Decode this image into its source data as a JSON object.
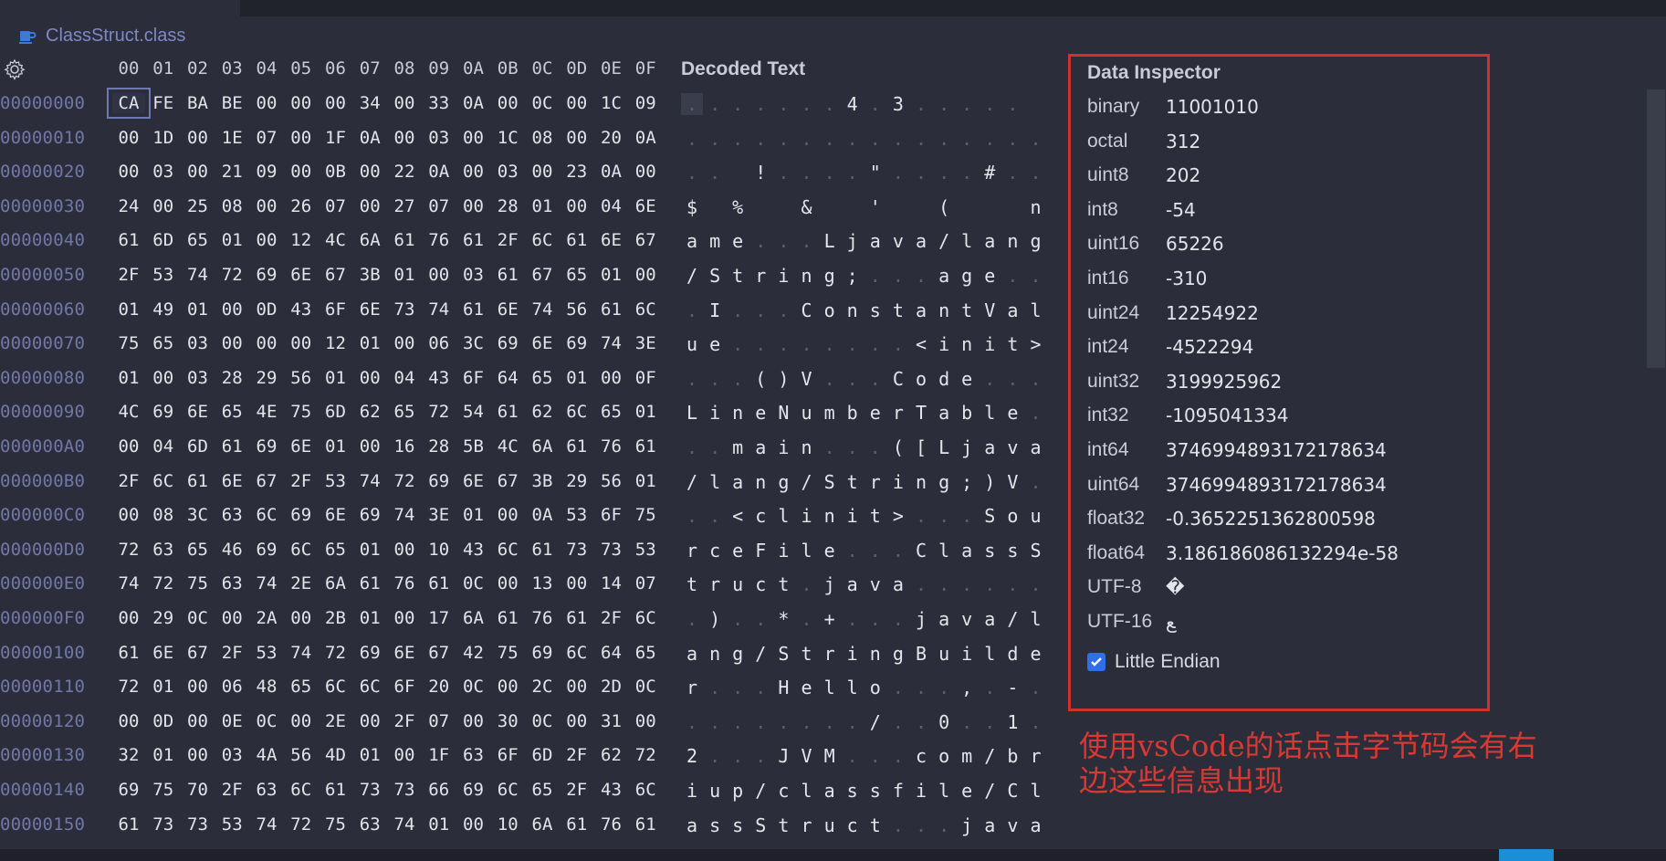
{
  "tab": {
    "title": "ClassStruct.class",
    "icon": "coffee-cup-icon"
  },
  "hex_columns": [
    "00",
    "01",
    "02",
    "03",
    "04",
    "05",
    "06",
    "07",
    "08",
    "09",
    "0A",
    "0B",
    "0C",
    "0D",
    "0E",
    "0F"
  ],
  "decoded_header": "Decoded Text",
  "rows": [
    {
      "addr": "00000000",
      "bytes": [
        "CA",
        "FE",
        "BA",
        "BE",
        "00",
        "00",
        "00",
        "34",
        "00",
        "33",
        "0A",
        "00",
        "0C",
        "00",
        "1C",
        "09"
      ],
      "text": [
        ".",
        ".",
        ".",
        ".",
        ".",
        ".",
        ".",
        "4",
        ".",
        "3",
        ".",
        ".",
        ".",
        ".",
        ".",
        "."
      ]
    },
    {
      "addr": "00000010",
      "bytes": [
        "00",
        "1D",
        "00",
        "1E",
        "07",
        "00",
        "1F",
        "0A",
        "00",
        "03",
        "00",
        "1C",
        "08",
        "00",
        "20",
        "0A"
      ],
      "text": [
        ".",
        ".",
        ".",
        ".",
        ".",
        ".",
        ".",
        ".",
        ".",
        ".",
        ".",
        ".",
        ".",
        ".",
        ".",
        "."
      ]
    },
    {
      "addr": "00000020",
      "bytes": [
        "00",
        "03",
        "00",
        "21",
        "09",
        "00",
        "0B",
        "00",
        "22",
        "0A",
        "00",
        "03",
        "00",
        "23",
        "0A",
        "00"
      ],
      "text": [
        ".",
        ".",
        ".",
        "!",
        ".",
        ".",
        ".",
        ".",
        "\"",
        ".",
        ".",
        ".",
        ".",
        "#",
        ".",
        "."
      ]
    },
    {
      "addr": "00000030",
      "bytes": [
        "24",
        "00",
        "25",
        "08",
        "00",
        "26",
        "07",
        "00",
        "27",
        "07",
        "00",
        "28",
        "01",
        "00",
        "04",
        "6E"
      ],
      "text": [
        "$",
        ".",
        "%",
        ".",
        ".",
        "&",
        ".",
        ".",
        "'",
        ".",
        ".",
        "(",
        ".",
        ".",
        ".",
        "n"
      ]
    },
    {
      "addr": "00000040",
      "bytes": [
        "61",
        "6D",
        "65",
        "01",
        "00",
        "12",
        "4C",
        "6A",
        "61",
        "76",
        "61",
        "2F",
        "6C",
        "61",
        "6E",
        "67"
      ],
      "text": [
        "a",
        "m",
        "e",
        ".",
        ".",
        ".",
        "L",
        "j",
        "a",
        "v",
        "a",
        "/",
        "l",
        "a",
        "n",
        "g"
      ]
    },
    {
      "addr": "00000050",
      "bytes": [
        "2F",
        "53",
        "74",
        "72",
        "69",
        "6E",
        "67",
        "3B",
        "01",
        "00",
        "03",
        "61",
        "67",
        "65",
        "01",
        "00"
      ],
      "text": [
        "/",
        "S",
        "t",
        "r",
        "i",
        "n",
        "g",
        ";",
        ".",
        ".",
        ".",
        "a",
        "g",
        "e",
        ".",
        "."
      ]
    },
    {
      "addr": "00000060",
      "bytes": [
        "01",
        "49",
        "01",
        "00",
        "0D",
        "43",
        "6F",
        "6E",
        "73",
        "74",
        "61",
        "6E",
        "74",
        "56",
        "61",
        "6C"
      ],
      "text": [
        ".",
        "I",
        ".",
        ".",
        ".",
        "C",
        "o",
        "n",
        "s",
        "t",
        "a",
        "n",
        "t",
        "V",
        "a",
        "l"
      ]
    },
    {
      "addr": "00000070",
      "bytes": [
        "75",
        "65",
        "03",
        "00",
        "00",
        "00",
        "12",
        "01",
        "00",
        "06",
        "3C",
        "69",
        "6E",
        "69",
        "74",
        "3E"
      ],
      "text": [
        "u",
        "e",
        ".",
        ".",
        ".",
        ".",
        ".",
        ".",
        ".",
        ".",
        "<",
        "i",
        "n",
        "i",
        "t",
        ">"
      ]
    },
    {
      "addr": "00000080",
      "bytes": [
        "01",
        "00",
        "03",
        "28",
        "29",
        "56",
        "01",
        "00",
        "04",
        "43",
        "6F",
        "64",
        "65",
        "01",
        "00",
        "0F"
      ],
      "text": [
        ".",
        ".",
        ".",
        "(",
        ")",
        "V",
        ".",
        ".",
        ".",
        "C",
        "o",
        "d",
        "e",
        ".",
        ".",
        "."
      ]
    },
    {
      "addr": "00000090",
      "bytes": [
        "4C",
        "69",
        "6E",
        "65",
        "4E",
        "75",
        "6D",
        "62",
        "65",
        "72",
        "54",
        "61",
        "62",
        "6C",
        "65",
        "01"
      ],
      "text": [
        "L",
        "i",
        "n",
        "e",
        "N",
        "u",
        "m",
        "b",
        "e",
        "r",
        "T",
        "a",
        "b",
        "l",
        "e",
        "."
      ]
    },
    {
      "addr": "000000A0",
      "bytes": [
        "00",
        "04",
        "6D",
        "61",
        "69",
        "6E",
        "01",
        "00",
        "16",
        "28",
        "5B",
        "4C",
        "6A",
        "61",
        "76",
        "61"
      ],
      "text": [
        ".",
        ".",
        "m",
        "a",
        "i",
        "n",
        ".",
        ".",
        ".",
        "(",
        "[",
        "L",
        "j",
        "a",
        "v",
        "a"
      ]
    },
    {
      "addr": "000000B0",
      "bytes": [
        "2F",
        "6C",
        "61",
        "6E",
        "67",
        "2F",
        "53",
        "74",
        "72",
        "69",
        "6E",
        "67",
        "3B",
        "29",
        "56",
        "01"
      ],
      "text": [
        "/",
        "l",
        "a",
        "n",
        "g",
        "/",
        "S",
        "t",
        "r",
        "i",
        "n",
        "g",
        ";",
        ")",
        "V",
        "."
      ]
    },
    {
      "addr": "000000C0",
      "bytes": [
        "00",
        "08",
        "3C",
        "63",
        "6C",
        "69",
        "6E",
        "69",
        "74",
        "3E",
        "01",
        "00",
        "0A",
        "53",
        "6F",
        "75"
      ],
      "text": [
        ".",
        ".",
        "<",
        "c",
        "l",
        "i",
        "n",
        "i",
        "t",
        ">",
        ".",
        ".",
        ".",
        "S",
        "o",
        "u"
      ]
    },
    {
      "addr": "000000D0",
      "bytes": [
        "72",
        "63",
        "65",
        "46",
        "69",
        "6C",
        "65",
        "01",
        "00",
        "10",
        "43",
        "6C",
        "61",
        "73",
        "73",
        "53"
      ],
      "text": [
        "r",
        "c",
        "e",
        "F",
        "i",
        "l",
        "e",
        ".",
        ".",
        ".",
        "C",
        "l",
        "a",
        "s",
        "s",
        "S"
      ]
    },
    {
      "addr": "000000E0",
      "bytes": [
        "74",
        "72",
        "75",
        "63",
        "74",
        "2E",
        "6A",
        "61",
        "76",
        "61",
        "0C",
        "00",
        "13",
        "00",
        "14",
        "07"
      ],
      "text": [
        "t",
        "r",
        "u",
        "c",
        "t",
        ".",
        "j",
        "a",
        "v",
        "a",
        ".",
        ".",
        ".",
        ".",
        ".",
        "."
      ]
    },
    {
      "addr": "000000F0",
      "bytes": [
        "00",
        "29",
        "0C",
        "00",
        "2A",
        "00",
        "2B",
        "01",
        "00",
        "17",
        "6A",
        "61",
        "76",
        "61",
        "2F",
        "6C"
      ],
      "text": [
        ".",
        ")",
        ".",
        ".",
        "*",
        ".",
        "+",
        ".",
        ".",
        ".",
        "j",
        "a",
        "v",
        "a",
        "/",
        "l"
      ]
    },
    {
      "addr": "00000100",
      "bytes": [
        "61",
        "6E",
        "67",
        "2F",
        "53",
        "74",
        "72",
        "69",
        "6E",
        "67",
        "42",
        "75",
        "69",
        "6C",
        "64",
        "65"
      ],
      "text": [
        "a",
        "n",
        "g",
        "/",
        "S",
        "t",
        "r",
        "i",
        "n",
        "g",
        "B",
        "u",
        "i",
        "l",
        "d",
        "e"
      ]
    },
    {
      "addr": "00000110",
      "bytes": [
        "72",
        "01",
        "00",
        "06",
        "48",
        "65",
        "6C",
        "6C",
        "6F",
        "20",
        "0C",
        "00",
        "2C",
        "00",
        "2D",
        "0C"
      ],
      "text": [
        "r",
        ".",
        ".",
        ".",
        "H",
        "e",
        "l",
        "l",
        "o",
        ".",
        ".",
        ".",
        ",",
        ".",
        "-",
        "."
      ]
    },
    {
      "addr": "00000120",
      "bytes": [
        "00",
        "0D",
        "00",
        "0E",
        "0C",
        "00",
        "2E",
        "00",
        "2F",
        "07",
        "00",
        "30",
        "0C",
        "00",
        "31",
        "00"
      ],
      "text": [
        ".",
        ".",
        ".",
        ".",
        ".",
        ".",
        ".",
        ".",
        "/",
        ".",
        ".",
        "0",
        ".",
        ".",
        "1",
        "."
      ]
    },
    {
      "addr": "00000130",
      "bytes": [
        "32",
        "01",
        "00",
        "03",
        "4A",
        "56",
        "4D",
        "01",
        "00",
        "1F",
        "63",
        "6F",
        "6D",
        "2F",
        "62",
        "72"
      ],
      "text": [
        "2",
        ".",
        ".",
        ".",
        "J",
        "V",
        "M",
        ".",
        ".",
        ".",
        "c",
        "o",
        "m",
        "/",
        "b",
        "r"
      ]
    },
    {
      "addr": "00000140",
      "bytes": [
        "69",
        "75",
        "70",
        "2F",
        "63",
        "6C",
        "61",
        "73",
        "73",
        "66",
        "69",
        "6C",
        "65",
        "2F",
        "43",
        "6C"
      ],
      "text": [
        "i",
        "u",
        "p",
        "/",
        "c",
        "l",
        "a",
        "s",
        "s",
        "f",
        "i",
        "l",
        "e",
        "/",
        "C",
        "l"
      ]
    },
    {
      "addr": "00000150",
      "bytes": [
        "61",
        "73",
        "73",
        "53",
        "74",
        "72",
        "75",
        "63",
        "74",
        "01",
        "00",
        "10",
        "6A",
        "61",
        "76",
        "61"
      ],
      "text": [
        "a",
        "s",
        "s",
        "S",
        "t",
        "r",
        "u",
        "c",
        "t",
        ".",
        ".",
        ".",
        "j",
        "a",
        "v",
        "a"
      ]
    }
  ],
  "dot_char": ".",
  "blank_positions": {
    "00000000": [
      15
    ],
    "00000020": [
      2
    ],
    "00000030": [
      1,
      3,
      4,
      6,
      7,
      9,
      10,
      12,
      13,
      14
    ]
  },
  "selected": {
    "row": 0,
    "col": 0
  },
  "inspector": {
    "title": "Data Inspector",
    "fields": [
      {
        "label": "binary",
        "value": "11001010"
      },
      {
        "label": "octal",
        "value": "312"
      },
      {
        "label": "uint8",
        "value": "202"
      },
      {
        "label": "int8",
        "value": "-54"
      },
      {
        "label": "uint16",
        "value": "65226"
      },
      {
        "label": "int16",
        "value": "-310"
      },
      {
        "label": "uint24",
        "value": "12254922"
      },
      {
        "label": "int24",
        "value": "-4522294"
      },
      {
        "label": "uint32",
        "value": "3199925962"
      },
      {
        "label": "int32",
        "value": "-1095041334"
      },
      {
        "label": "int64",
        "value": "3746994893172178634"
      },
      {
        "label": "uint64",
        "value": "3746994893172178634"
      },
      {
        "label": "float32",
        "value": "-0.3652251362800598"
      },
      {
        "label": "float64",
        "value": "3.186186086132294e-58"
      },
      {
        "label": "UTF-8",
        "value": "�"
      },
      {
        "label": "UTF-16",
        "value": "ﻊ"
      }
    ],
    "little_endian": {
      "label": "Little Endian",
      "checked": true
    }
  },
  "annotation": "使用vsCode的话点击字节码会有右边这些信息出现",
  "colors": {
    "background": "#2b2d3a",
    "address": "#7178a8",
    "annotation": "#d83a33",
    "highlight_border": "#d0312d",
    "checkbox": "#2f6fea"
  }
}
